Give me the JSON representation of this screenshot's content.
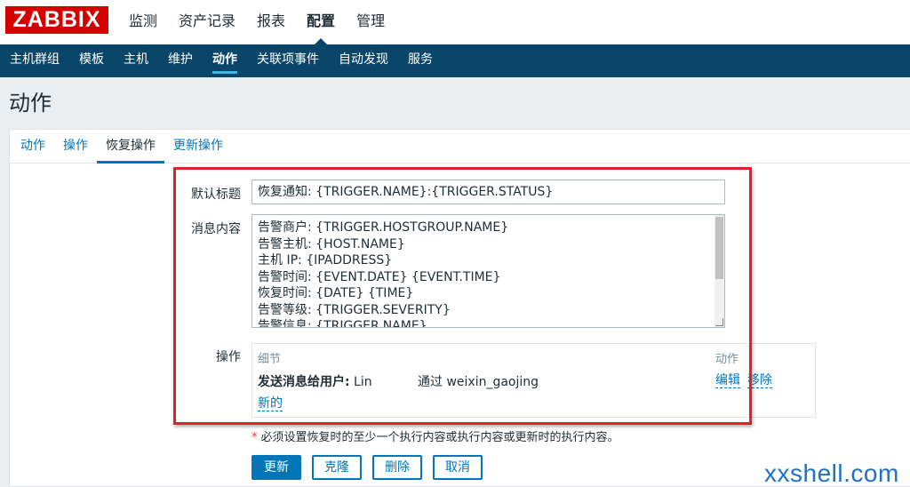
{
  "logo": "ZABBIX",
  "top_nav": [
    "监测",
    "资产记录",
    "报表",
    "配置",
    "管理"
  ],
  "top_nav_active": "配置",
  "sub_nav": [
    "主机群组",
    "模板",
    "主机",
    "维护",
    "动作",
    "关联项事件",
    "自动发现",
    "服务"
  ],
  "sub_nav_active": "动作",
  "page_title": "动作",
  "tabs": [
    "动作",
    "操作",
    "恢复操作",
    "更新操作"
  ],
  "tabs_active": "恢复操作",
  "form": {
    "default_subject_label": "默认标题",
    "default_subject_value": "恢复通知: {TRIGGER.NAME}:{TRIGGER.STATUS}",
    "message_label": "消息内容",
    "message_lines": [
      "告警商户: {TRIGGER.HOSTGROUP.NAME}",
      "告警主机: {HOST.NAME}",
      "主机 IP: {IPADDRESS}",
      "告警时间: {EVENT.DATE} {EVENT.TIME}",
      "恢复时间: {DATE} {TIME}",
      "告警等级: {TRIGGER.SEVERITY}",
      "告警信息: {TRIGGER.NAME}"
    ],
    "operations_label": "操作",
    "operations": {
      "col_details": "细节",
      "col_action": "动作",
      "row_bold": "发送消息给用户:",
      "row_user": " Lin",
      "row_via": "通过 weixin_gaojing",
      "edit_link": "编辑",
      "remove_link": "移除",
      "new_link": "新的"
    },
    "required_star": "*",
    "required_note": "必须设置恢复时的至少一个执行内容或执行内容或更新时的执行内容。"
  },
  "buttons": {
    "update": "更新",
    "clone": "克隆",
    "delete": "删除",
    "cancel": "取消"
  },
  "watermark": "xxshell.com",
  "colors": {
    "brand_red": "#d40000",
    "nav_dark": "#0a466a",
    "link_blue": "#0275b8",
    "highlight_frame": "#e0202a"
  }
}
